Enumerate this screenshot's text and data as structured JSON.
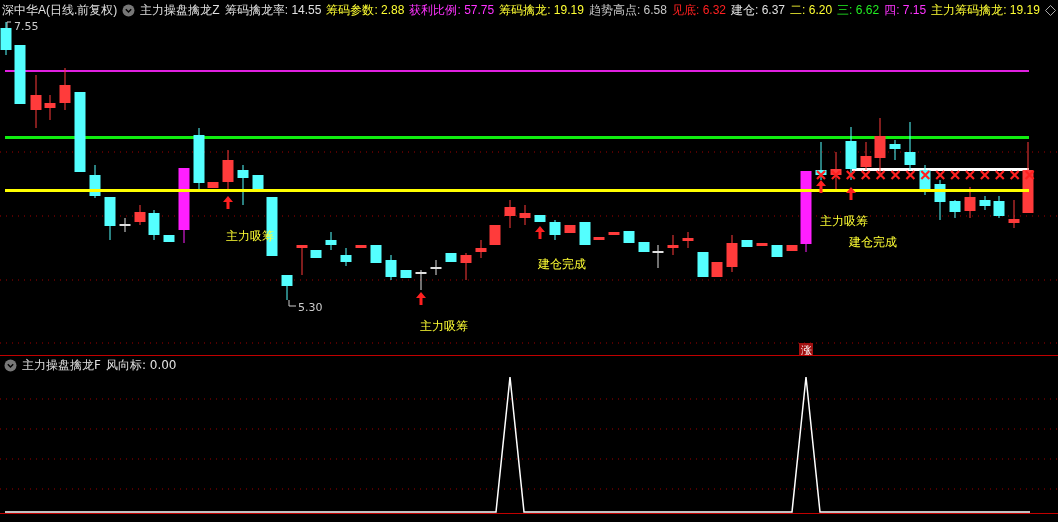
{
  "header": {
    "title": "深中华A(日线.前复权)",
    "indicator": "主力操盘擒龙Z",
    "values": [
      {
        "label": "筹码擒龙率:",
        "value": "14.55",
        "color": "#e0e0e0"
      },
      {
        "label": "筹码参数:",
        "value": "2.88",
        "color": "#ffff33"
      },
      {
        "label": "获利比例:",
        "value": "57.75",
        "color": "#ff33ff"
      },
      {
        "label": "筹码擒龙:",
        "value": "19.19",
        "color": "#ffff33"
      },
      {
        "label": "趋势高点:",
        "value": "6.58",
        "color": "#c8c8c8"
      },
      {
        "label": "见底:",
        "value": "6.32",
        "color": "#ff2020"
      },
      {
        "label": "建仓:",
        "value": "6.37",
        "color": "#e0e0e0"
      },
      {
        "label": "二:",
        "value": "6.20",
        "color": "#ffff33"
      },
      {
        "label": "三:",
        "value": "6.62",
        "color": "#22ee22"
      },
      {
        "label": "四:",
        "value": "7.15",
        "color": "#ff33ff"
      },
      {
        "label": "主力筹码擒龙:",
        "value": "19.19",
        "color": "#ffff33"
      }
    ]
  },
  "main_chart": {
    "high_label": "7.55",
    "low_label": "5.30",
    "annotations": [
      {
        "text": "主力吸筹"
      },
      {
        "text": "建仓完成"
      },
      {
        "text": "主力吸筹"
      },
      {
        "text": "主力吸筹"
      },
      {
        "text": "建仓完成"
      }
    ],
    "badge": "涨"
  },
  "sub_panel": {
    "indicator": "主力操盘擒龙F",
    "reading": "风向标: 0.00"
  }
}
